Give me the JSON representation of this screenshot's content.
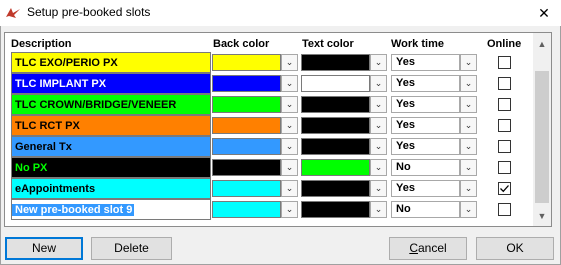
{
  "window": {
    "title": "Setup pre-booked slots",
    "close_symbol": "✕"
  },
  "columns": {
    "description": "Description",
    "back_color": "Back color",
    "text_color": "Text color",
    "work_time": "Work time",
    "online": "Online"
  },
  "rows": [
    {
      "description": "TLC EXO/PERIO PX",
      "back": "#ffff00",
      "text": "#000000",
      "work_time": "Yes",
      "online": false
    },
    {
      "description": "TLC IMPLANT PX",
      "back": "#0000ff",
      "text": "#ffffff",
      "work_time": "Yes",
      "online": false
    },
    {
      "description": "TLC CROWN/BRIDGE/VENEER",
      "back": "#00ff00",
      "text": "#000000",
      "work_time": "Yes",
      "online": false
    },
    {
      "description": "TLC RCT PX",
      "back": "#ff8000",
      "text": "#000000",
      "work_time": "Yes",
      "online": false
    },
    {
      "description": "General Tx",
      "back": "#3399ff",
      "text": "#000000",
      "work_time": "Yes",
      "online": false
    },
    {
      "description": "No PX",
      "back": "#000000",
      "text": "#00ff00",
      "work_time": "No",
      "online": false
    },
    {
      "description": "eAppointments",
      "back": "#00ffff",
      "text": "#000000",
      "work_time": "Yes",
      "online": true
    },
    {
      "description": "New pre-booked slot 9",
      "back": "#00ffff",
      "text": "#000000",
      "work_time": "No",
      "online": false,
      "selected": true
    }
  ],
  "selection_color": "#3399ff",
  "buttons": {
    "new": "New",
    "delete": "Delete",
    "cancel_pre": "",
    "cancel_key": "C",
    "cancel_post": "ancel",
    "ok": "OK"
  },
  "icons": {
    "dropdown": "chevron-down-icon",
    "scroll_up": "scroll-up-icon",
    "scroll_down": "scroll-down-icon",
    "app": "app-bird-icon",
    "check": "checkmark-icon"
  }
}
